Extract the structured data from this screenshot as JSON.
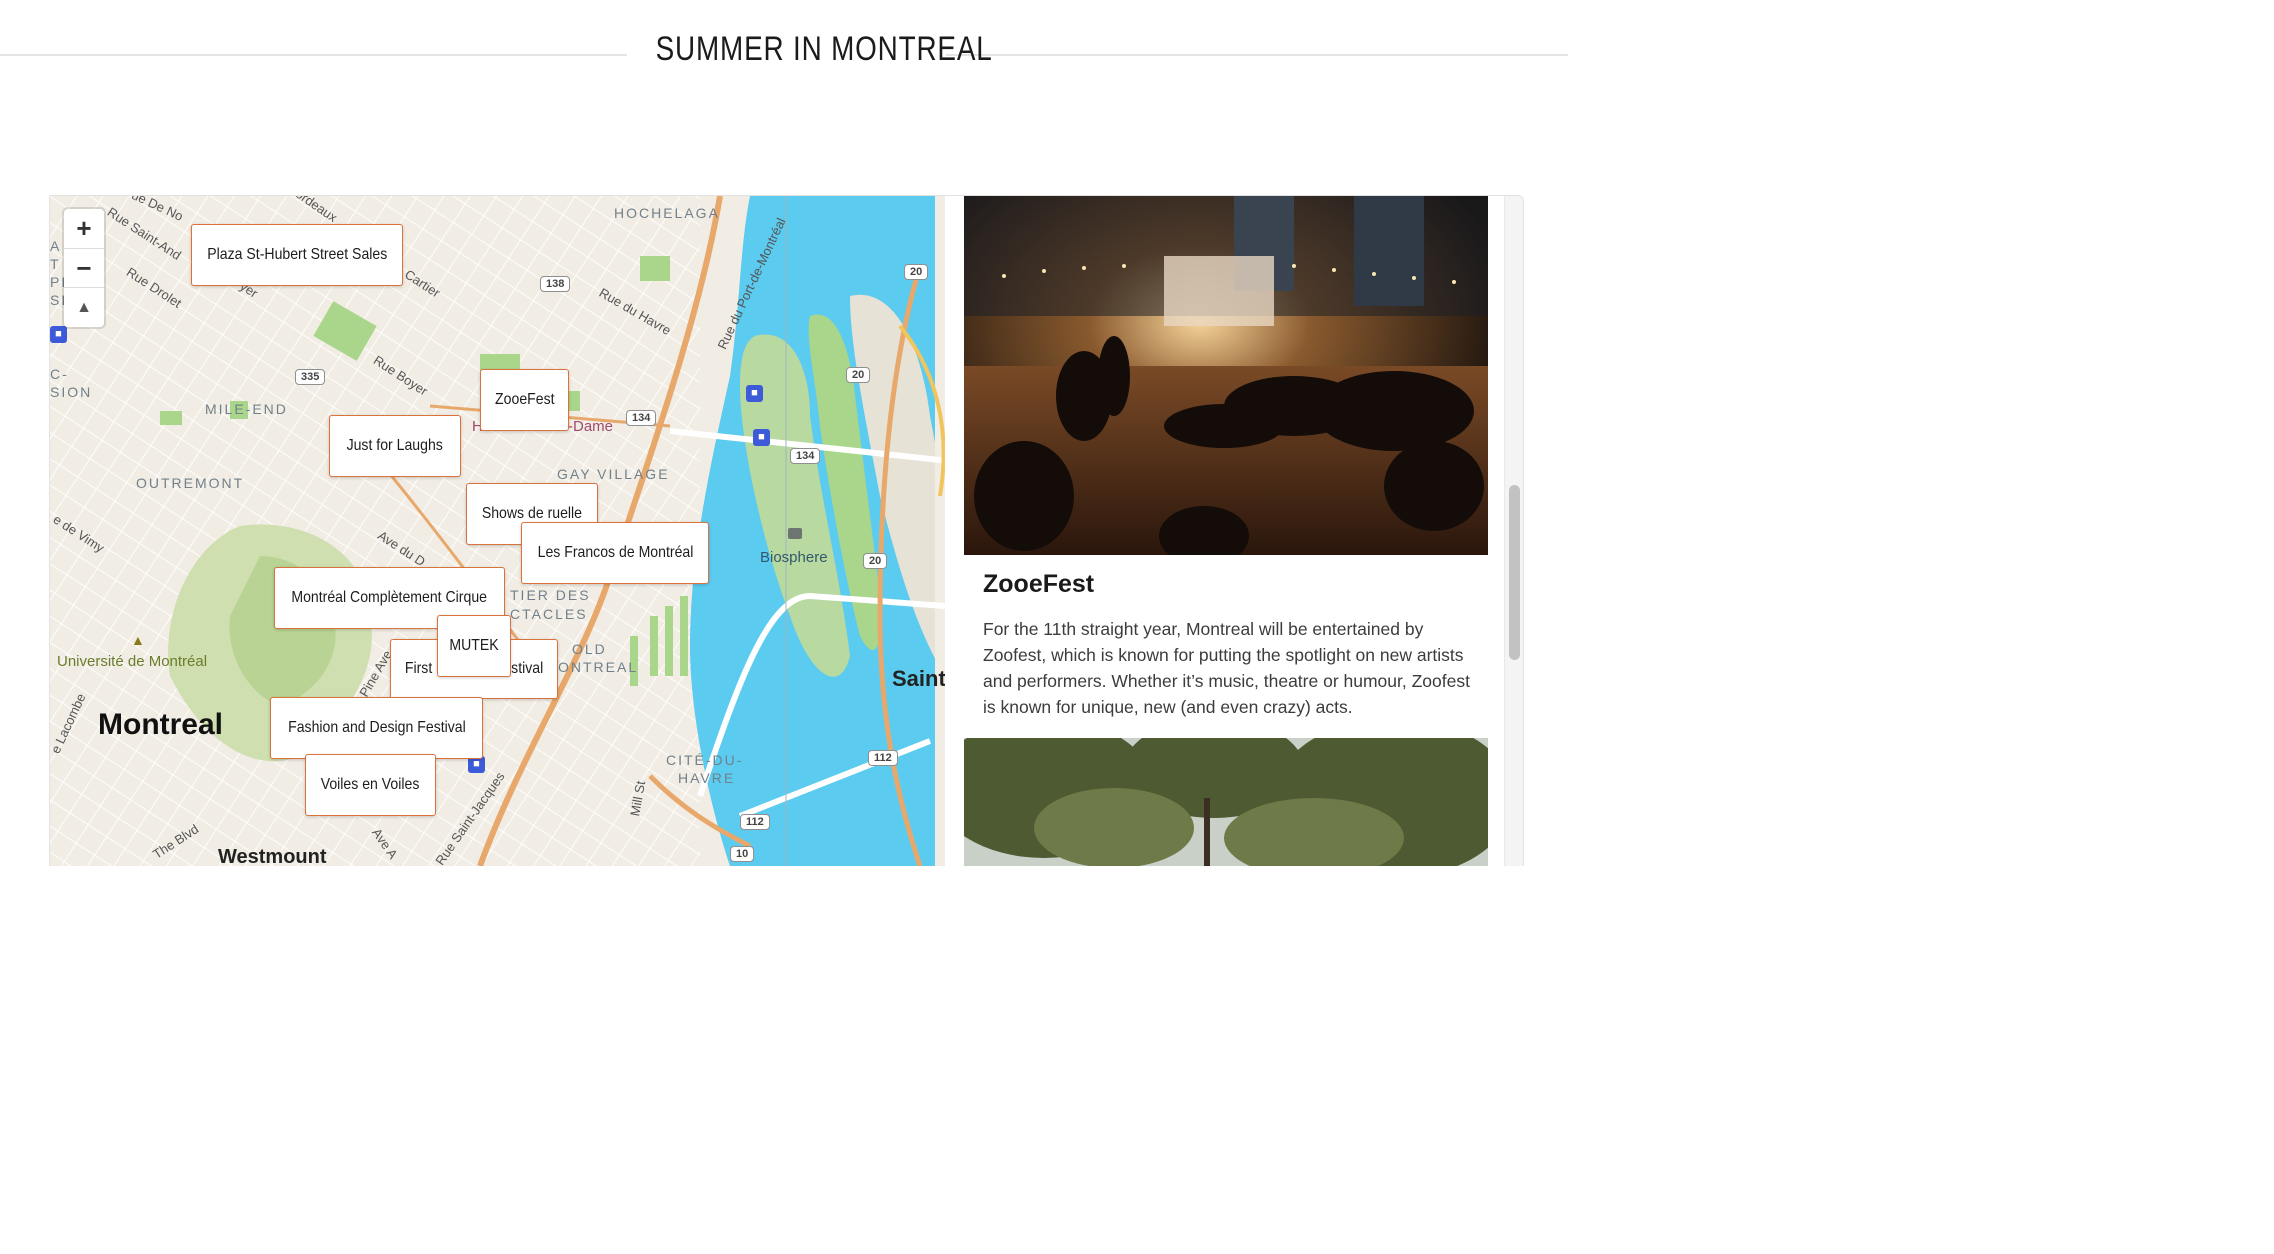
{
  "page": {
    "title": "SUMMER IN MONTREAL"
  },
  "map": {
    "controls": {
      "zoom_in": "+",
      "zoom_out": "−",
      "compass": "▲"
    },
    "area_labels": [
      "HOCHELAGA",
      "MILE-END",
      "OUTREMONT",
      "GAY VILLAGE",
      "TIER DES",
      "CTACLES",
      "OLD",
      "ONTREAL",
      "CITÉ-DU-",
      "HAVRE",
      "C-",
      "SION",
      "A",
      "T",
      "PI",
      "SI"
    ],
    "street_labels": [
      "Rue Saint-And",
      "ue De No",
      "ordeaux",
      "Rue Drolet",
      "Cartier",
      "Rue du Havre",
      "Rue du Port-de-Montréal",
      "Rue Boyer",
      "e de Vimy",
      "Ave du D",
      "Pine Ave",
      "Mill St",
      "Rue Saint-Jacques",
      "e Lacombe",
      "The Blvd",
      "Ave A",
      "yer"
    ],
    "routes": [
      "138",
      "20",
      "335",
      "134",
      "134",
      "20",
      "20",
      "112",
      "112",
      "10"
    ],
    "poi": {
      "biosphere": "Biosphere",
      "universite": "Université de Montréal",
      "notre_dame_left": "H",
      "notre_dame": "-Dame"
    },
    "cities": {
      "montreal": "Montreal",
      "westmount": "Westmount",
      "saint": "Saint"
    },
    "markers": [
      "Plaza St-Hubert Street Sales",
      "ZooeFest",
      "Just for Laughs",
      "Shows de ruelle",
      "Les Francos de Montréal",
      "Montréal Complètement Cirque",
      "MUTEK",
      "First",
      "stival",
      "Fashion and Design Festival",
      "Voiles en Voiles"
    ]
  },
  "sidebar": {
    "card": {
      "title": "ZooeFest",
      "text": "For the 11th straight year, Montreal will be entertained by Zoofest, which is known for putting the spotlight on new artists and performers. Whether it’s music, theatre or humour, Zoofest is known for unique, new (and even crazy) acts."
    }
  },
  "colors": {
    "marker_border": "#d9733b",
    "water": "#5ccbf0",
    "park": "#a9d68a",
    "major_road": "#e8a86b",
    "transit": "#3d5bd8"
  }
}
